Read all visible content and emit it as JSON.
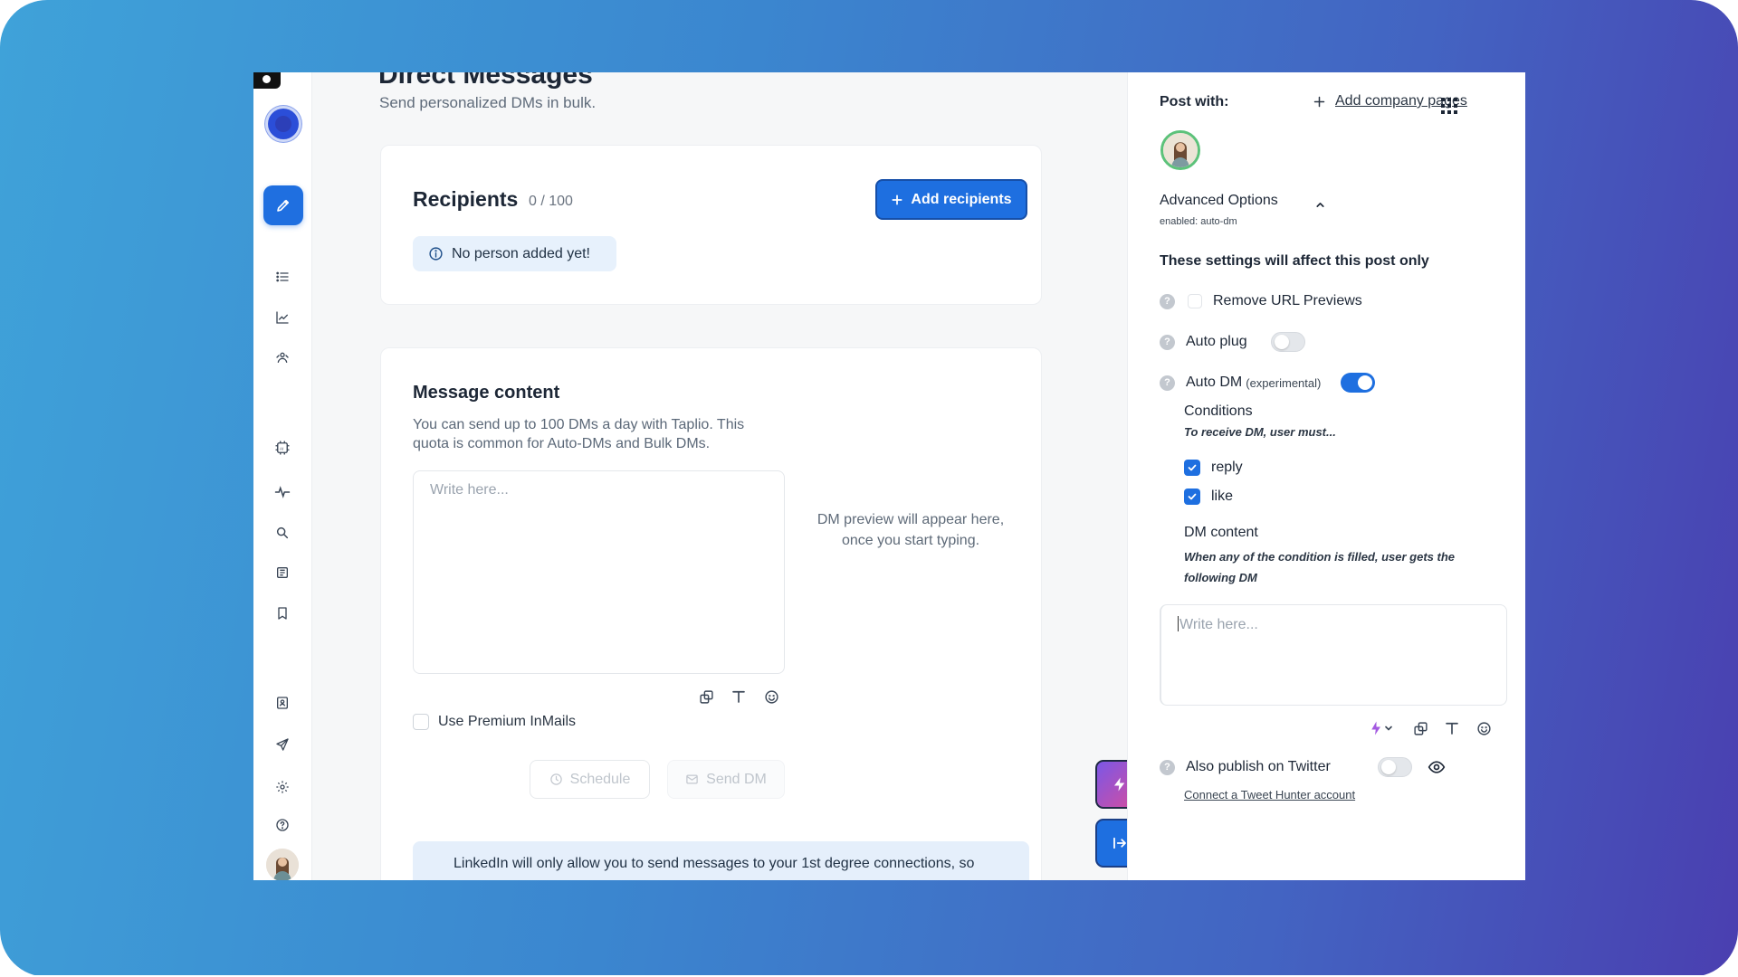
{
  "page": {
    "title": "Direct Messages",
    "subtitle": "Send personalized DMs in bulk."
  },
  "sidebar": {
    "icons": [
      "logo-icon",
      "status-icon",
      "pencil-icon",
      "list-icon",
      "chart-icon",
      "audience-icon",
      "ai-chip-icon",
      "pulse-icon",
      "search-icon",
      "library-icon",
      "bookmark-icon",
      "contact-icon",
      "send-icon",
      "settings-icon",
      "help-icon",
      "avatar"
    ]
  },
  "recipients": {
    "title": "Recipients",
    "count": "0 / 100",
    "add_button": "Add recipients",
    "empty_notice": "No person added yet!"
  },
  "message": {
    "title": "Message content",
    "description": "You can send up to 100 DMs a day with Taplio. This quota is common for Auto-DMs and Bulk DMs.",
    "placeholder": "Write here...",
    "preview_text": "DM preview will appear here, once you start typing.",
    "premium_label": "Use Premium InMails",
    "schedule_button": "Schedule",
    "send_button": "Send DM",
    "banner_text": "LinkedIn will only allow you to send messages to your 1st degree connections, so"
  },
  "right_panel": {
    "post_with": "Post with:",
    "add_company_pages": "Add company pages",
    "advanced_title": "Advanced Options",
    "advanced_sub": "enabled: auto-dm",
    "affect_note": "These settings will affect this post only",
    "options": {
      "remove_url": "Remove URL Previews",
      "auto_plug": "Auto plug",
      "auto_dm": "Auto DM",
      "auto_dm_tag": "(experimental)"
    },
    "conditions_title": "Conditions",
    "conditions_sub": "To receive DM, user must...",
    "condition_reply": "reply",
    "condition_like": "like",
    "dm_content_title": "DM content",
    "dm_content_sub": "When any of the condition is filled, user gets the following DM",
    "dm_placeholder": "Write here...",
    "twitter_label": "Also publish on Twitter",
    "twitter_link": "Connect a Tweet Hunter account",
    "auto_plug_on": false,
    "auto_dm_on": true,
    "twitter_on": false
  },
  "colors": {
    "accent": "#1e6fe0",
    "gradient_start": "#3fa2d9",
    "gradient_end": "#4a3fb0"
  }
}
